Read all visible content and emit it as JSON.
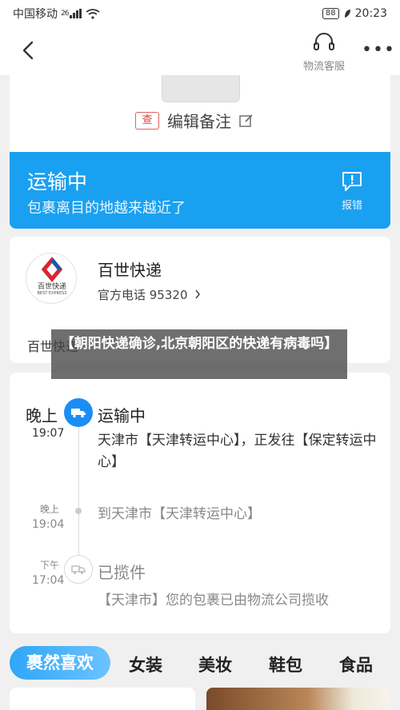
{
  "status_bar": {
    "carrier": "中国移动",
    "network": "26",
    "battery": "88",
    "time": "20:23"
  },
  "nav": {
    "service_label": "物流客服"
  },
  "remark": {
    "tag": "查",
    "label": "编辑备注"
  },
  "banner": {
    "title": "运输中",
    "subtitle": "包裹离目的地越来越近了",
    "report_label": "报错"
  },
  "courier": {
    "logo_name": "百世快递",
    "logo_en": "BEST EXPRESS",
    "name": "百世快递",
    "phone": "官方电话 95320",
    "partial_text": "百世快递"
  },
  "overlay": {
    "caption": "【朝阳快递确诊,北京朝阳区的快递有病毒吗】"
  },
  "timeline": [
    {
      "period": "晚上",
      "time": "19:07",
      "status": "运输中",
      "desc": "天津市【天津转运中心】，正发往【保定转运中心】"
    },
    {
      "period": "晚上",
      "time": "19:04",
      "desc": "到天津市【天津转运中心】"
    },
    {
      "period": "下午",
      "time": "17:04",
      "status": "已揽件",
      "desc": "【天津市】您的包裹已由物流公司揽收"
    }
  ],
  "tabs": [
    "裹然喜欢",
    "女装",
    "美妆",
    "鞋包",
    "食品"
  ],
  "colors": {
    "accent": "#1aa0f0",
    "timeline_dot": "#1a8ef5",
    "tag_red": "#e03c3c"
  }
}
